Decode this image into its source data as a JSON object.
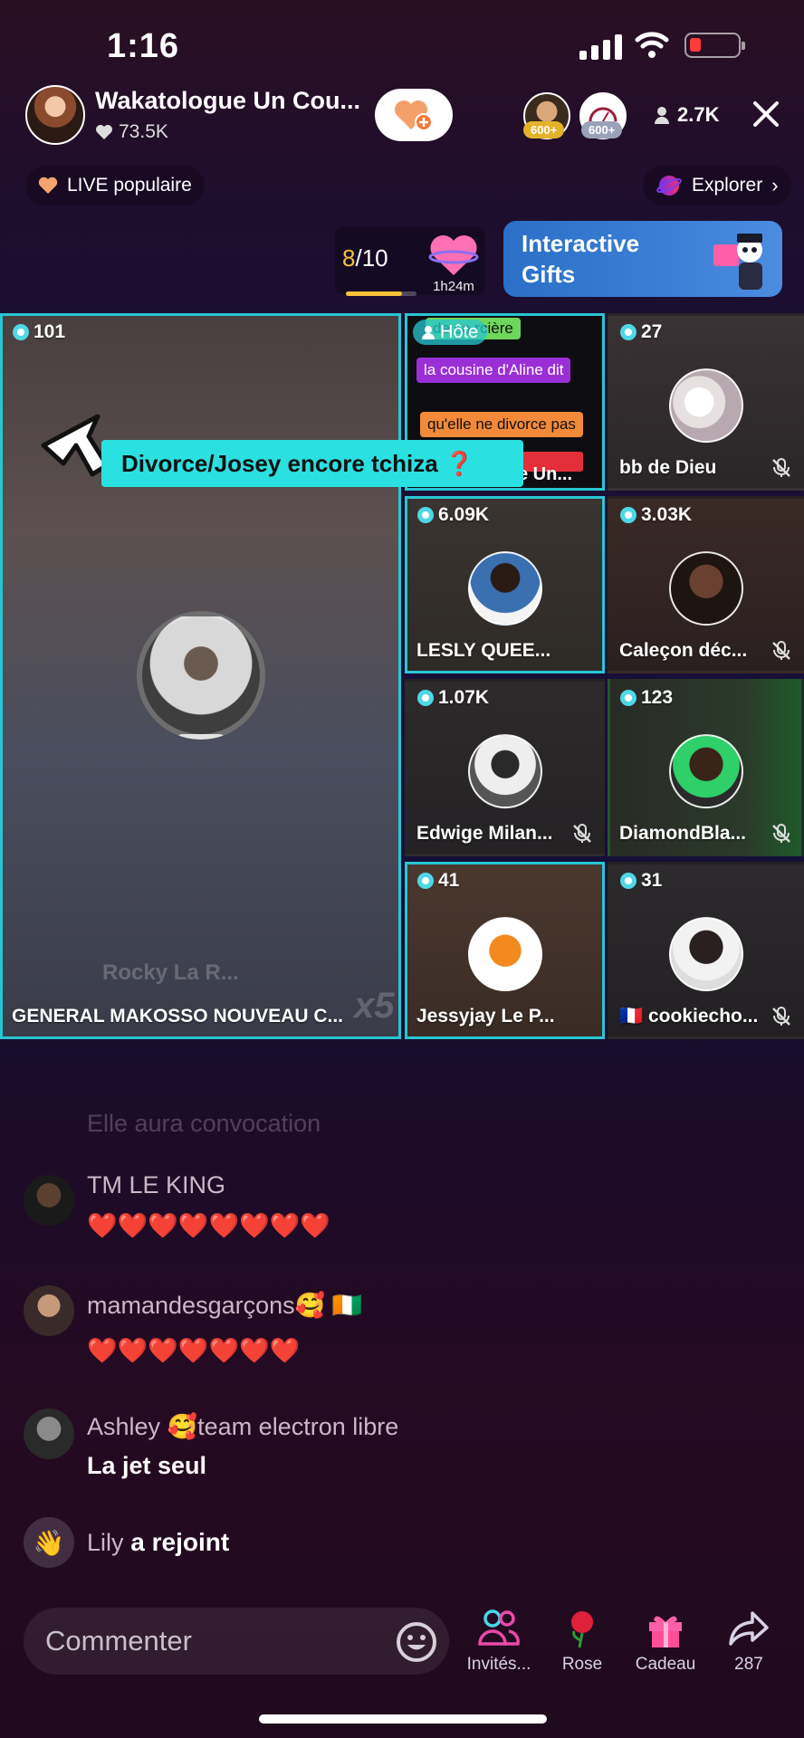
{
  "status": {
    "time": "1:16"
  },
  "host": {
    "name": "Wakatologue Un Cou...",
    "likes": "73.5K"
  },
  "top_viewers": [
    {
      "badge": "600+"
    },
    {
      "badge": "600+"
    }
  ],
  "viewer_count": "2.7K",
  "live_popular": "LIVE populaire",
  "explorer": "Explorer",
  "goal": {
    "current": "8",
    "total": "/10",
    "progress": 0.8,
    "timer": "1h24m"
  },
  "gifts_banner": {
    "line1": "Interactive",
    "line2": "Gifts"
  },
  "main_tile": {
    "count": "101",
    "name": "GENERAL MAKOSSO NOUVEAU C...",
    "ghost_name": "Rocky La R...",
    "ghost_mult": "x5"
  },
  "host_tile": {
    "label": "Hôte",
    "lines": [
      "de so.rcière",
      "la cousine d'Aline dit",
      "qu'elle ne divorce pas"
    ],
    "bottom": "e Un..."
  },
  "banner_pointer": {
    "text": "Divorce/Josey encore tchiza ❓"
  },
  "tiles": [
    {
      "count": "27",
      "name": "bb de Dieu",
      "muted": true
    },
    {
      "count": "6.09K",
      "name": "LESLY  QUEE...",
      "muted": false
    },
    {
      "count": "3.03K",
      "name": "Caleçon déc...",
      "muted": true
    },
    {
      "count": "1.07K",
      "name": "Edwige  Milan...",
      "muted": true
    },
    {
      "count": "123",
      "name": "DiamondBla...",
      "muted": true
    },
    {
      "count": "41",
      "name": "Jessyjay Le P...",
      "muted": false
    },
    {
      "count": "31",
      "name": "🇫🇷 cookiecho...",
      "muted": true
    }
  ],
  "chat": {
    "faded": "Elle aura convocation",
    "messages": [
      {
        "name": "TM LE KING",
        "text": "❤️❤️❤️❤️❤️❤️❤️❤️"
      },
      {
        "name": "mamandesgarçons🥰 🇨🇮",
        "text": "❤️❤️❤️❤️❤️❤️❤️"
      },
      {
        "name": "Ashley 🥰team electron libre",
        "text": "La jet seul"
      }
    ],
    "join": {
      "name": "Lily",
      "text": "a rejoint"
    }
  },
  "bottom_bar": {
    "comment_placeholder": "Commenter",
    "invite": "Invités...",
    "rose": "Rose",
    "gift": "Cadeau",
    "share_count": "287"
  }
}
